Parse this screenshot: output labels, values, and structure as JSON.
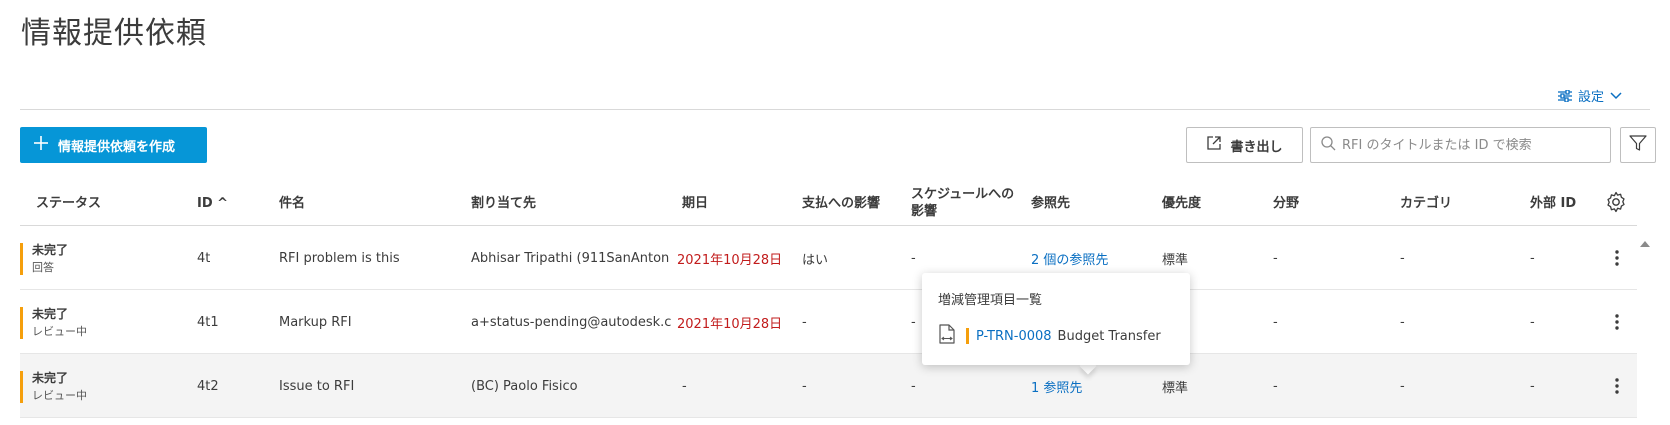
{
  "page": {
    "title": "情報提供依頼",
    "settings_label": "設定",
    "create_button": "情報提供依頼を作成",
    "export_button": "書き出し",
    "search_placeholder": "RFI のタイトルまたは ID で検索"
  },
  "columns": {
    "status": "ステータス",
    "id": "ID ^",
    "subject": "件名",
    "assignee": "割り当て先",
    "due": "期日",
    "cost_impact": "支払への影響",
    "schedule_impact": "スケジュールへの影響",
    "references": "参照先",
    "priority": "優先度",
    "discipline": "分野",
    "category": "カテゴリ",
    "external_id": "外部 ID"
  },
  "rows": [
    {
      "status": "未完了",
      "status_sub": "回答",
      "id": "4t",
      "subject": "RFI problem is this",
      "assignee": "Abhisar Tripathi (911SanAnton",
      "due": "2021年10月28日",
      "cost_impact": "はい",
      "schedule_impact": "-",
      "references": "2 個の参照先",
      "priority": "標準",
      "discipline": "-",
      "category": "-",
      "external_id": "-"
    },
    {
      "status": "未完了",
      "status_sub": "レビュー中",
      "id": "4t1",
      "subject": "Markup RFI",
      "assignee": "a+status-pending@autodesk.c",
      "due": "2021年10月28日",
      "cost_impact": "-",
      "schedule_impact": "-",
      "references": "",
      "priority": "",
      "discipline": "-",
      "category": "-",
      "external_id": "-"
    },
    {
      "status": "未完了",
      "status_sub": "レビュー中",
      "id": "4t2",
      "subject": "Issue to RFI",
      "assignee": "(BC) Paolo Fisico",
      "due": "-",
      "cost_impact": "-",
      "schedule_impact": "-",
      "references": "1 参照先",
      "priority": "標準",
      "discipline": "-",
      "category": "-",
      "external_id": "-"
    }
  ],
  "popover": {
    "title": "増減管理項目一覧",
    "item_code": "P-TRN-0008",
    "item_name": "Budget Transfer"
  },
  "colors": {
    "primary": "#0696d7",
    "link": "#0a6fc2",
    "overdue": "#c21c1c",
    "status_accent": "#f59f0c"
  },
  "icons": [
    "settings-sliders-icon",
    "chevron-down-icon",
    "plus-icon",
    "export-icon",
    "search-icon",
    "filter-icon",
    "gear-icon",
    "more-vertical-icon",
    "document-icon",
    "scroll-up-icon"
  ]
}
